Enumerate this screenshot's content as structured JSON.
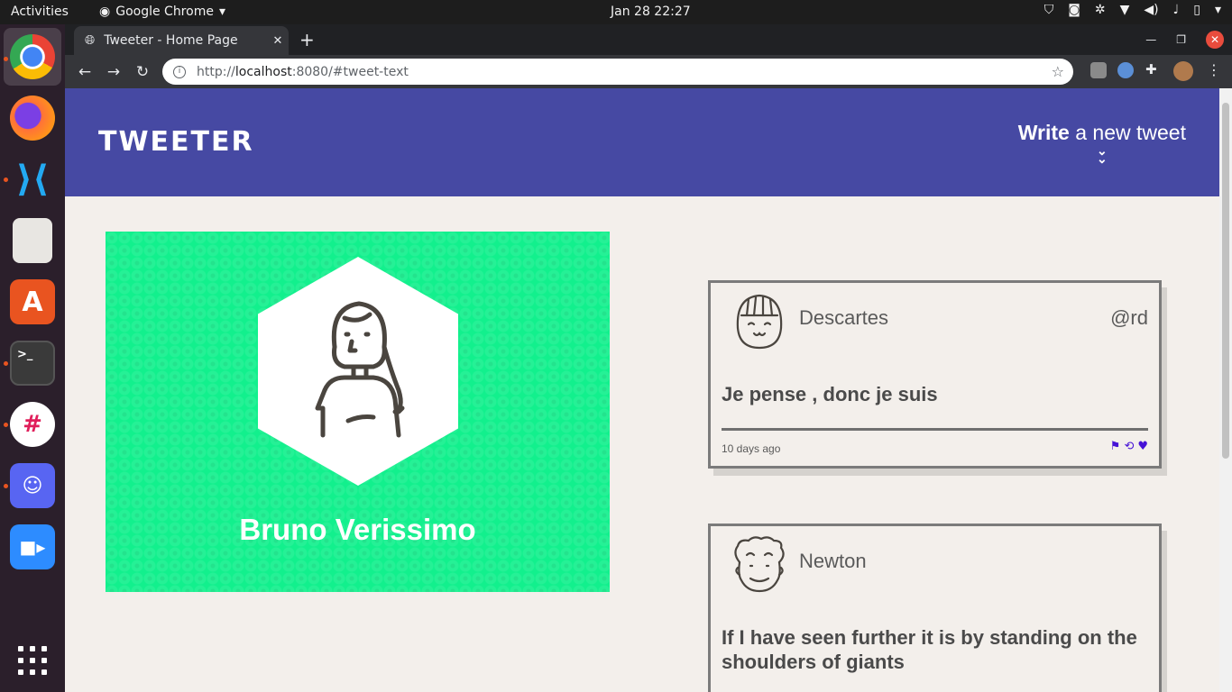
{
  "os": {
    "activities": "Activities",
    "app_name": "Google Chrome",
    "clock": "Jan 28  22:27"
  },
  "dock": {
    "apps": [
      "chrome-icon",
      "firefox-icon",
      "vscode-icon",
      "files-icon",
      "software-center-icon",
      "terminal-icon",
      "slack-icon",
      "discord-icon",
      "zoom-icon"
    ]
  },
  "browser": {
    "tab_title": "Tweeter - Home Page",
    "url_prefix": "http://",
    "url_host": "localhost",
    "url_rest": ":8080/#tweet-text"
  },
  "header": {
    "brand": "TWEETER",
    "compose_bold": "Write",
    "compose_rest": " a new tweet"
  },
  "profile": {
    "name": "Bruno Verissimo"
  },
  "tweets": [
    {
      "name": "Descartes",
      "handle": "@rd",
      "text": "Je pense , donc je suis",
      "time": "10 days ago"
    },
    {
      "name": "Newton",
      "handle": "",
      "text": "If I have seen further it is by standing on the shoulders of giants",
      "time": ""
    }
  ],
  "colors": {
    "nav": "#4649a3",
    "profile_bg": "#12f08d",
    "page_bg": "#f3efeb",
    "action_icons": "#4612d6"
  }
}
